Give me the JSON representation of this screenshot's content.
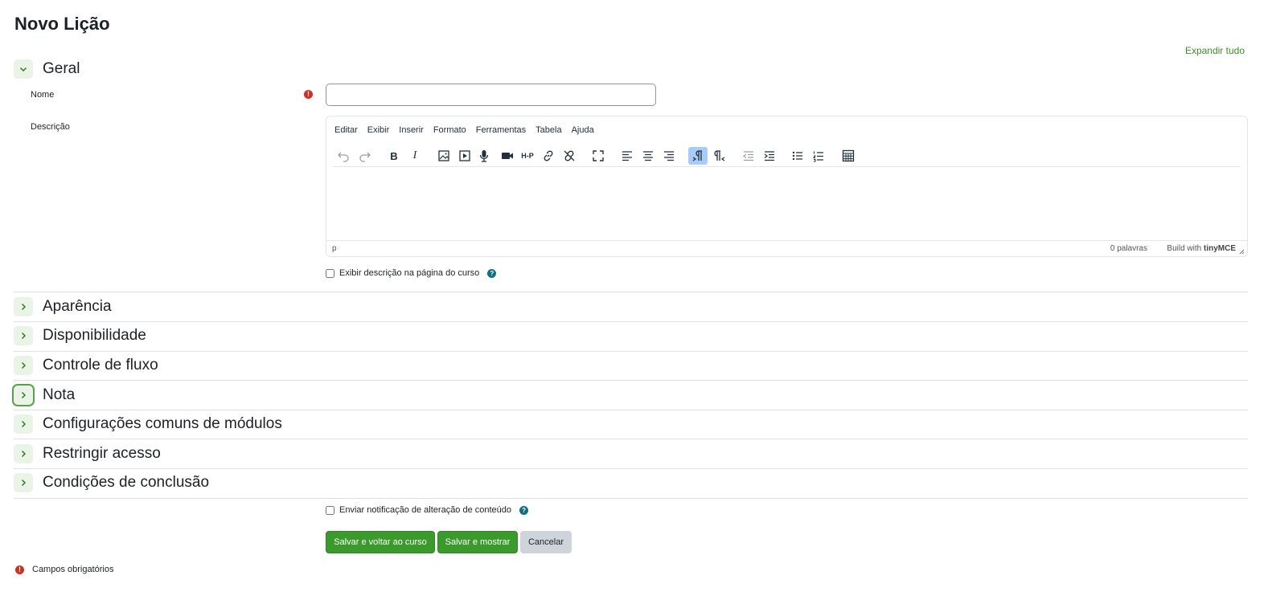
{
  "page": {
    "title": "Novo Lição",
    "expand_all": "Expandir tudo"
  },
  "general": {
    "title": "Geral",
    "name_label": "Nome",
    "name_value": "",
    "description_label": "Descrição",
    "show_description_label": "Exibir descrição na página do curso"
  },
  "editor": {
    "menus": [
      "Editar",
      "Exibir",
      "Inserir",
      "Formato",
      "Ferramentas",
      "Tabela",
      "Ajuda"
    ],
    "toolbar_icons": [
      "undo-icon",
      "redo-icon",
      "bold-icon",
      "italic-icon",
      "image-icon",
      "media-icon",
      "record-audio-icon",
      "record-video-icon",
      "h5p-icon",
      "link-icon",
      "unlink-icon",
      "fullscreen-icon",
      "align-left-icon",
      "align-center-icon",
      "align-right-icon",
      "ltr-icon",
      "rtl-icon",
      "outdent-icon",
      "indent-icon",
      "bullet-list-icon",
      "numbered-list-icon",
      "table-icon"
    ],
    "h5p_label": "H-P",
    "bold_label": "B",
    "italic_label": "I",
    "status_path": "p",
    "word_count": "0 palavras",
    "built_with": "Build with",
    "brand": "tinyMCE"
  },
  "sections": [
    {
      "title": "Aparência"
    },
    {
      "title": "Disponibilidade"
    },
    {
      "title": "Controle de fluxo"
    },
    {
      "title": "Nota"
    },
    {
      "title": "Configurações comuns de módulos"
    },
    {
      "title": "Restringir acesso"
    },
    {
      "title": "Condições de conclusão"
    }
  ],
  "footer": {
    "notify_label": "Enviar notificação de alteração de conteúdo",
    "save_return": "Salvar e voltar ao curso",
    "save_display": "Salvar e mostrar",
    "cancel": "Cancelar",
    "required_note": "Campos obrigatórios"
  },
  "icons": {
    "required": "!",
    "help": "?"
  },
  "colors": {
    "accent_green": "#3a9a2b",
    "link_green": "#3c8f2a",
    "required_red": "#ca3120",
    "help_teal": "#0f6e84",
    "active_tool": "#a6ccf7"
  }
}
